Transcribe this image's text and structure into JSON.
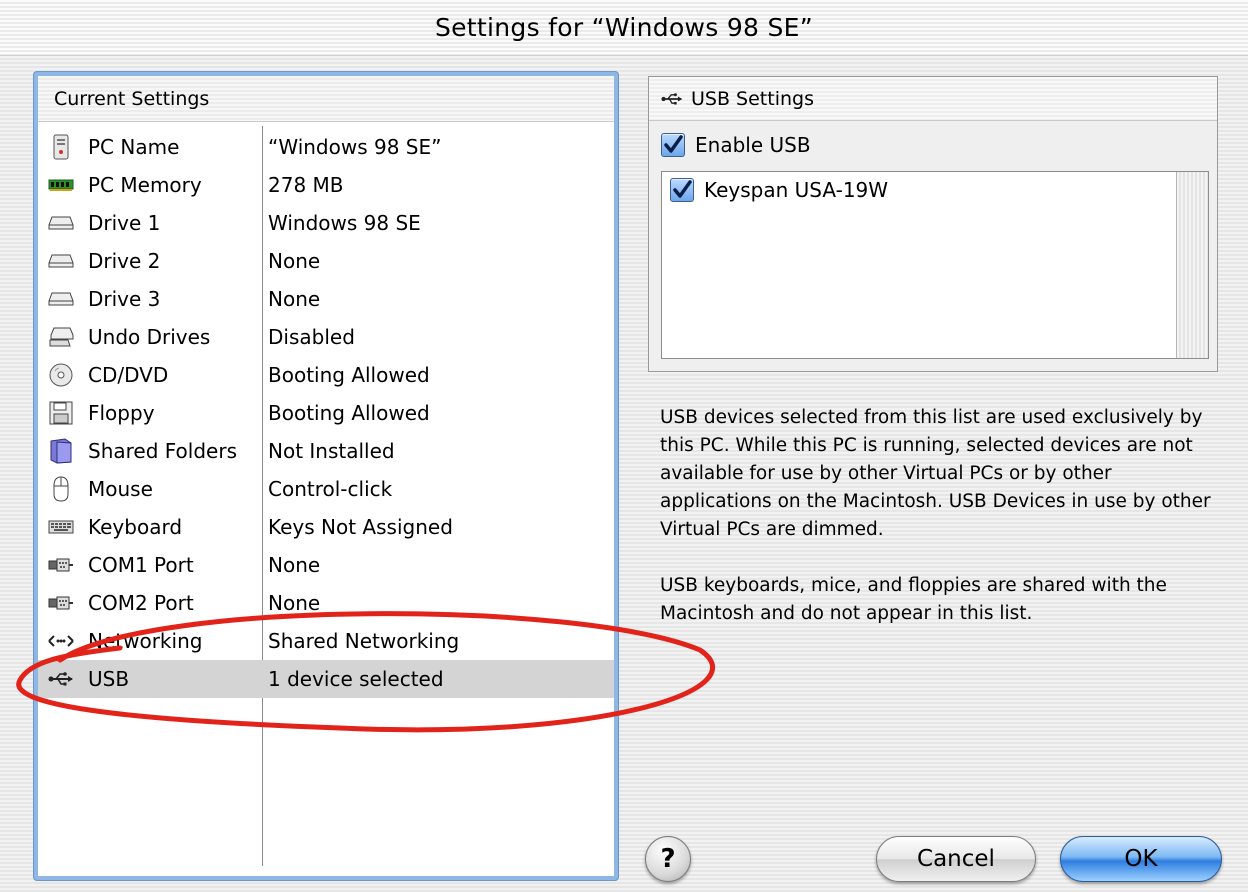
{
  "window": {
    "title": "Settings for “Windows 98 SE”"
  },
  "settings_list": {
    "header": "Current Settings",
    "rows": [
      {
        "name": "PC Name",
        "value": "“Windows 98 SE”",
        "icon": "pc-tower-icon"
      },
      {
        "name": "PC Memory",
        "value": "278 MB",
        "icon": "memory-chip-icon"
      },
      {
        "name": "Drive 1",
        "value": "Windows 98 SE",
        "icon": "hard-drive-icon"
      },
      {
        "name": "Drive 2",
        "value": "None",
        "icon": "hard-drive-icon"
      },
      {
        "name": "Drive 3",
        "value": "None",
        "icon": "hard-drive-icon"
      },
      {
        "name": "Undo Drives",
        "value": "Disabled",
        "icon": "undo-drive-icon"
      },
      {
        "name": "CD/DVD",
        "value": "Booting Allowed",
        "icon": "cd-icon"
      },
      {
        "name": "Floppy",
        "value": "Booting Allowed",
        "icon": "floppy-icon"
      },
      {
        "name": "Shared Folders",
        "value": "Not Installed",
        "icon": "folder-icon"
      },
      {
        "name": "Mouse",
        "value": "Control-click",
        "icon": "mouse-icon"
      },
      {
        "name": "Keyboard",
        "value": "Keys Not Assigned",
        "icon": "keyboard-icon"
      },
      {
        "name": "COM1 Port",
        "value": "None",
        "icon": "serial-port-icon"
      },
      {
        "name": "COM2 Port",
        "value": "None",
        "icon": "serial-port-icon"
      },
      {
        "name": "Networking",
        "value": "Shared Networking",
        "icon": "network-icon"
      },
      {
        "name": "USB",
        "value": "1 device selected",
        "icon": "usb-icon",
        "selected": true
      }
    ]
  },
  "usb_settings": {
    "header": "USB Settings",
    "enable_label": "Enable USB",
    "enable_checked": true,
    "devices": [
      {
        "name": "Keyspan USA-19W",
        "checked": true
      }
    ]
  },
  "info": {
    "paragraph1": "USB devices selected from this list are used exclusively by this PC. While this PC is running, selected devices are not available for use by other Virtual PCs or by other applications on the Macintosh. USB Devices in use by other Virtual PCs are dimmed.",
    "paragraph2": "USB keyboards, mice, and floppies are shared with the Macintosh and do not appear in this list."
  },
  "buttons": {
    "help": "?",
    "cancel": "Cancel",
    "ok": "OK"
  },
  "colors": {
    "annotation": "#e2231a",
    "selection_row": "#d4d4d4",
    "focus_ring": "#8fb7e6"
  }
}
